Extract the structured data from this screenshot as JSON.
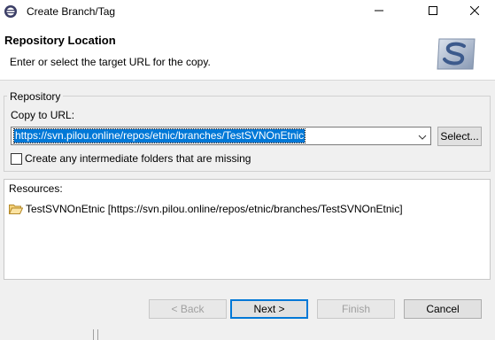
{
  "window": {
    "title": "Create Branch/Tag",
    "icon": "eclipse-icon",
    "controls": [
      "minimize-icon",
      "maximize-icon",
      "close-icon"
    ]
  },
  "header": {
    "title": "Repository Location",
    "description": "Enter or select the target URL for the copy.",
    "logo": "subversion-logo"
  },
  "repository": {
    "group_label": "Repository",
    "copy_to_url_label": "Copy to URL:",
    "url_value": "https://svn.pilou.online/repos/etnic/branches/TestSVNOnEtnic",
    "select_button": "Select...",
    "create_folders_label": "Create any intermediate folders that are missing",
    "create_folders_checked": false
  },
  "resources": {
    "label": "Resources:",
    "items": [
      {
        "text": "TestSVNOnEtnic [https://svn.pilou.online/repos/etnic/branches/TestSVNOnEtnic]",
        "icon": "folder-icon"
      }
    ]
  },
  "buttons": {
    "back": "< Back",
    "next": "Next >",
    "finish": "Finish",
    "cancel": "Cancel"
  },
  "colors": {
    "selection": "#0078d7",
    "dialog_bg": "#f0f0f0",
    "disabled_text": "#a0a0a0"
  }
}
